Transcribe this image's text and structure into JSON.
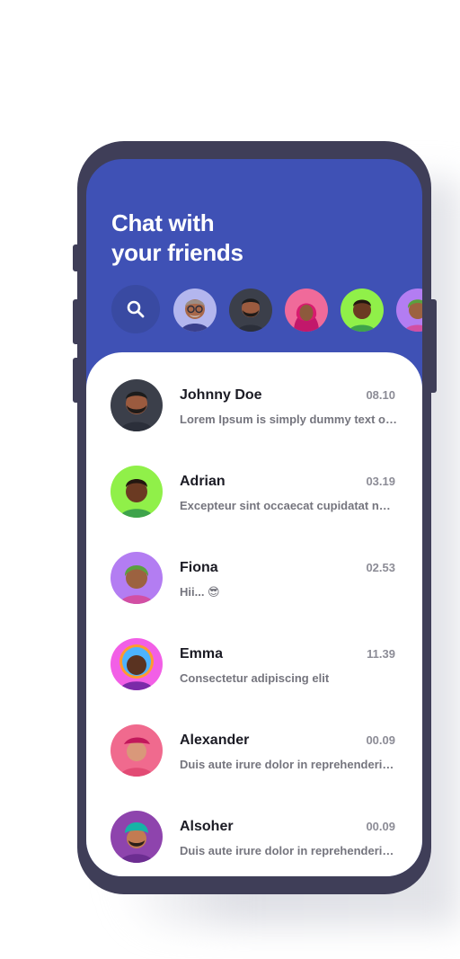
{
  "header": {
    "title_line1": "Chat with",
    "title_line2": "your friends"
  },
  "stories": [
    {
      "icon": "avatar-glasses-man",
      "bg": "#b3b6ee"
    },
    {
      "icon": "avatar-bearded-man",
      "bg": "#3b3f4a"
    },
    {
      "icon": "avatar-woman-hijab",
      "bg": "#f06a9a"
    },
    {
      "icon": "avatar-man-green",
      "bg": "#90f049"
    },
    {
      "icon": "avatar-woman-purple",
      "bg": "#b37df2"
    }
  ],
  "chats": [
    {
      "name": "Johnny Doe",
      "time": "08.10",
      "message": "Lorem Ipsum is simply dummy text of the printing",
      "avatar_bg": "#3b3f4a"
    },
    {
      "name": "Adrian",
      "time": "03.19",
      "message": "Excepteur sint occaecat cupidatat non proident",
      "avatar_bg": "#90f049"
    },
    {
      "name": "Fiona",
      "time": "02.53",
      "message": "Hii... 😎",
      "avatar_bg": "#b37df2"
    },
    {
      "name": "Emma",
      "time": "11.39",
      "message": "Consectetur adipiscing elit",
      "avatar_bg": "#f25fe6"
    },
    {
      "name": "Alexander",
      "time": "00.09",
      "message": "Duis aute irure dolor in reprehenderit in voluptate",
      "avatar_bg": "#f06a8e"
    },
    {
      "name": "Alsoher",
      "time": "00.09",
      "message": "Duis aute irure dolor in reprehenderit in voluptate",
      "avatar_bg": "#8e44ad"
    }
  ],
  "colors": {
    "accent": "#3f51b5",
    "frame": "#3f3e58"
  }
}
